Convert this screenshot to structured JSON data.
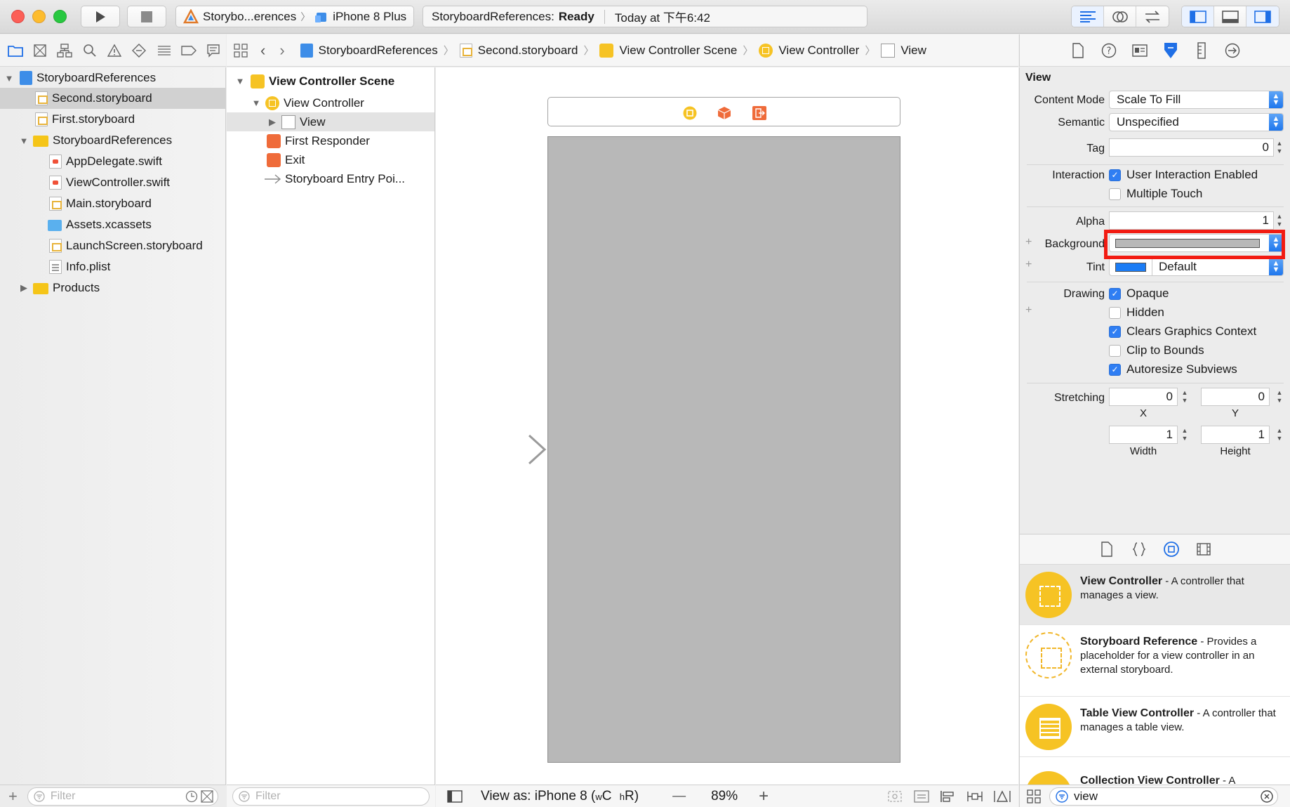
{
  "toolbar": {
    "scheme_name": "Storybo...erences",
    "device_name": "iPhone 8 Plus",
    "status_project": "StoryboardReferences:",
    "status_state": "Ready",
    "status_time": "Today at 下午6:42"
  },
  "navigator": {
    "items": [
      {
        "label": "StoryboardReferences"
      },
      {
        "label": "Second.storyboard"
      },
      {
        "label": "First.storyboard"
      },
      {
        "label": "StoryboardReferences"
      },
      {
        "label": "AppDelegate.swift"
      },
      {
        "label": "ViewController.swift"
      },
      {
        "label": "Main.storyboard"
      },
      {
        "label": "Assets.xcassets"
      },
      {
        "label": "LaunchScreen.storyboard"
      },
      {
        "label": "Info.plist"
      },
      {
        "label": "Products"
      }
    ],
    "filter_placeholder": "Filter"
  },
  "jumpbar": {
    "crumbs": [
      "StoryboardReferences",
      "Second.storyboard",
      "View Controller Scene",
      "View Controller",
      "View"
    ]
  },
  "outline": {
    "items": [
      {
        "label": "View Controller Scene"
      },
      {
        "label": "View Controller"
      },
      {
        "label": "View"
      },
      {
        "label": "First Responder"
      },
      {
        "label": "Exit"
      },
      {
        "label": "Storyboard Entry Poi..."
      }
    ],
    "filter_placeholder": "Filter"
  },
  "canvas": {
    "view_as_prefix": "View as: iPhone 8 (",
    "size_w": "w",
    "size_c": "C",
    "size_h": "h",
    "size_r": "R",
    "view_as_suffix": ")",
    "zoom": "89%",
    "zoom_minus": "—",
    "zoom_plus": "+"
  },
  "inspector": {
    "section_title": "View",
    "content_mode_label": "Content Mode",
    "content_mode_value": "Scale To Fill",
    "semantic_label": "Semantic",
    "semantic_value": "Unspecified",
    "tag_label": "Tag",
    "tag_value": "0",
    "interaction_label": "Interaction",
    "user_interaction_label": "User Interaction Enabled",
    "multiple_touch_label": "Multiple Touch",
    "alpha_label": "Alpha",
    "alpha_value": "1",
    "background_label": "Background",
    "background_color": "#b8b8b8",
    "tint_label": "Tint",
    "tint_value": "Default",
    "tint_color": "#1b7cf5",
    "drawing_label": "Drawing",
    "opaque_label": "Opaque",
    "hidden_label": "Hidden",
    "clears_label": "Clears Graphics Context",
    "clip_label": "Clip to Bounds",
    "autoresize_label": "Autoresize Subviews",
    "stretching_label": "Stretching",
    "stretch_x": "0",
    "stretch_y": "0",
    "stretch_w": "1",
    "stretch_h": "1",
    "x_label": "X",
    "y_label": "Y",
    "width_label": "Width",
    "height_label": "Height",
    "plus_symbol": "+",
    "highlight_color": "#f21b12"
  },
  "library": {
    "items": [
      {
        "title": "View Controller",
        "desc": " - A controller that manages a view."
      },
      {
        "title": "Storyboard Reference",
        "desc": " - Provides a placeholder for a view controller in an external storyboard."
      },
      {
        "title": "Table View Controller",
        "desc": " - A controller that manages a table view."
      },
      {
        "title": "Collection View Controller",
        "desc": " - A"
      }
    ],
    "filter_value": "view"
  }
}
